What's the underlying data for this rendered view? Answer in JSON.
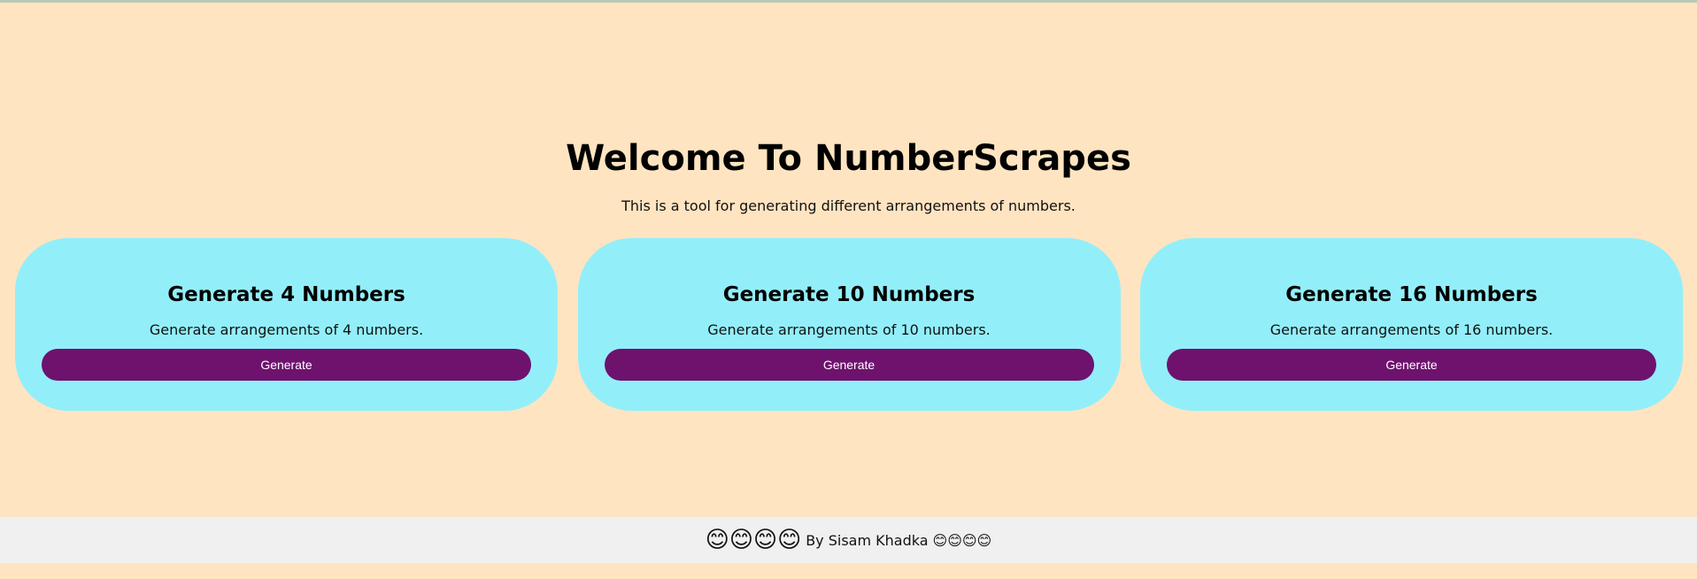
{
  "hero": {
    "title": "Welcome To NumberScrapes",
    "subtitle": "This is a tool for generating different arrangements of numbers."
  },
  "cards": [
    {
      "title": "Generate 4 Numbers",
      "description": "Generate arrangements of 4 numbers.",
      "button_label": "Generate"
    },
    {
      "title": "Generate 10 Numbers",
      "description": "Generate arrangements of 10 numbers.",
      "button_label": "Generate"
    },
    {
      "title": "Generate 16 Numbers",
      "description": "Generate arrangements of 16 numbers.",
      "button_label": "Generate"
    }
  ],
  "footer": {
    "emoji_left": "😊😊😊😊",
    "author_text": "By Sisam Khadka",
    "emoji_right": "😊😊😊😊"
  },
  "colors": {
    "background": "#ffe4c1",
    "card": "#92eff9",
    "button": "#6e126e",
    "footer": "#f0f0f0"
  }
}
